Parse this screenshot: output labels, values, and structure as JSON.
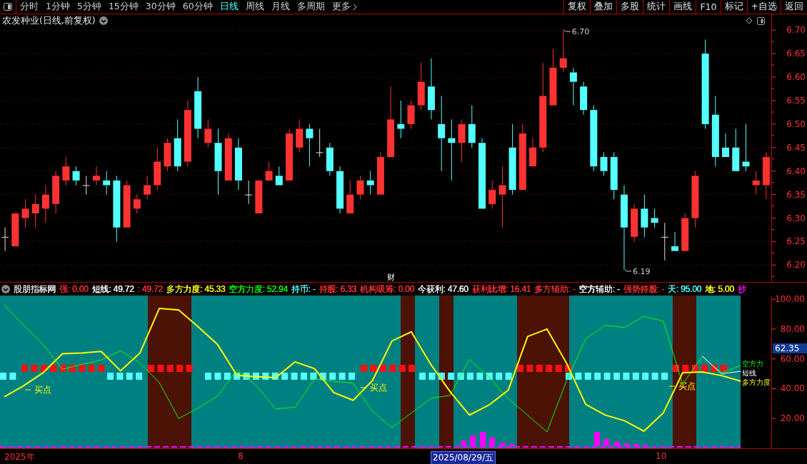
{
  "toolbar": {
    "periods": [
      {
        "label": "分时",
        "selected": false
      },
      {
        "label": "1分钟",
        "selected": false
      },
      {
        "label": "5分钟",
        "selected": false
      },
      {
        "label": "15分钟",
        "selected": false
      },
      {
        "label": "30分钟",
        "selected": false
      },
      {
        "label": "60分钟",
        "selected": false
      },
      {
        "label": "日线",
        "selected": true
      },
      {
        "label": "周线",
        "selected": false
      },
      {
        "label": "月线",
        "selected": false
      },
      {
        "label": "多周期",
        "selected": false
      },
      {
        "label": "更多",
        "selected": false
      }
    ],
    "buttons": [
      "复权",
      "叠加",
      "多股",
      "统计",
      "画线",
      "F10",
      "标记",
      "+自选",
      "返回"
    ]
  },
  "price_chart": {
    "title": "农发种业(日线,前复权)",
    "marker": "财",
    "chart_data": {
      "type": "candlestick",
      "categories": [
        null,
        null,
        null,
        null,
        null,
        null,
        null,
        null,
        null,
        null,
        null,
        null,
        null,
        null,
        null,
        null,
        null,
        null,
        null,
        null,
        null,
        null,
        null,
        null,
        null,
        null,
        null,
        null,
        null,
        null,
        null,
        null,
        null,
        null,
        null,
        null,
        null,
        null,
        null,
        null,
        null,
        null,
        null,
        null,
        null,
        null,
        null,
        null,
        null,
        null,
        null,
        null,
        null,
        null,
        null,
        null,
        null,
        null,
        null,
        null,
        null,
        null,
        null,
        null,
        null,
        null,
        null,
        null,
        null,
        null,
        null,
        null,
        null,
        null,
        null,
        null
      ],
      "ohlc": [
        [
          6.26,
          6.28,
          6.23,
          6.26
        ],
        [
          6.24,
          6.31,
          6.24,
          6.31
        ],
        [
          6.3,
          6.34,
          6.28,
          6.32
        ],
        [
          6.31,
          6.35,
          6.28,
          6.33
        ],
        [
          6.32,
          6.37,
          6.29,
          6.35
        ],
        [
          6.33,
          6.4,
          6.31,
          6.39
        ],
        [
          6.38,
          6.43,
          6.37,
          6.41
        ],
        [
          6.4,
          6.41,
          6.37,
          6.38
        ],
        [
          6.37,
          6.39,
          6.35,
          6.37
        ],
        [
          6.38,
          6.41,
          6.37,
          6.39
        ],
        [
          6.38,
          6.4,
          6.35,
          6.37
        ],
        [
          6.38,
          6.39,
          6.25,
          6.28
        ],
        [
          6.28,
          6.38,
          6.28,
          6.37
        ],
        [
          6.32,
          6.35,
          6.31,
          6.34
        ],
        [
          6.35,
          6.39,
          6.34,
          6.37
        ],
        [
          6.37,
          6.45,
          6.36,
          6.42
        ],
        [
          6.41,
          6.47,
          6.4,
          6.46
        ],
        [
          6.47,
          6.51,
          6.4,
          6.41
        ],
        [
          6.42,
          6.55,
          6.41,
          6.53
        ],
        [
          6.57,
          6.6,
          6.47,
          6.49
        ],
        [
          6.46,
          6.51,
          6.45,
          6.49
        ],
        [
          6.46,
          6.49,
          6.35,
          6.4
        ],
        [
          6.38,
          6.48,
          6.38,
          6.47
        ],
        [
          6.45,
          6.47,
          6.36,
          6.38
        ],
        [
          6.35,
          6.38,
          6.33,
          6.35
        ],
        [
          6.31,
          6.38,
          6.31,
          6.38
        ],
        [
          6.38,
          6.42,
          6.38,
          6.4
        ],
        [
          6.39,
          6.41,
          6.37,
          6.37
        ],
        [
          6.38,
          6.49,
          6.38,
          6.48
        ],
        [
          6.45,
          6.51,
          6.44,
          6.49
        ],
        [
          6.49,
          6.5,
          6.41,
          6.47
        ],
        [
          6.44,
          6.49,
          6.43,
          6.44
        ],
        [
          6.45,
          6.46,
          6.39,
          6.4
        ],
        [
          6.4,
          6.41,
          6.31,
          6.32
        ],
        [
          6.31,
          6.38,
          6.31,
          6.35
        ],
        [
          6.35,
          6.39,
          6.34,
          6.38
        ],
        [
          6.38,
          6.4,
          6.35,
          6.37
        ],
        [
          6.35,
          6.44,
          6.35,
          6.43
        ],
        [
          6.43,
          6.58,
          6.43,
          6.51
        ],
        [
          6.5,
          6.55,
          6.47,
          6.49
        ],
        [
          6.5,
          6.55,
          6.49,
          6.54
        ],
        [
          6.54,
          6.63,
          6.53,
          6.59
        ],
        [
          6.58,
          6.64,
          6.51,
          6.53
        ],
        [
          6.5,
          6.56,
          6.4,
          6.47
        ],
        [
          6.47,
          6.51,
          6.38,
          6.46
        ],
        [
          6.46,
          6.51,
          6.42,
          6.5
        ],
        [
          6.5,
          6.54,
          6.45,
          6.46
        ],
        [
          6.46,
          6.47,
          6.32,
          6.32
        ],
        [
          6.33,
          6.38,
          6.32,
          6.36
        ],
        [
          6.35,
          6.41,
          6.28,
          6.37
        ],
        [
          6.45,
          6.5,
          6.35,
          6.36
        ],
        [
          6.36,
          6.5,
          6.36,
          6.48
        ],
        [
          6.41,
          6.47,
          6.41,
          6.45
        ],
        [
          6.45,
          6.63,
          6.44,
          6.56
        ],
        [
          6.54,
          6.66,
          6.54,
          6.62
        ],
        [
          6.62,
          6.7,
          6.61,
          6.64
        ],
        [
          6.61,
          6.62,
          6.54,
          6.59
        ],
        [
          6.58,
          6.59,
          6.52,
          6.53
        ],
        [
          6.53,
          6.54,
          6.4,
          6.41
        ],
        [
          6.43,
          6.44,
          6.39,
          6.4
        ],
        [
          6.43,
          6.44,
          6.34,
          6.36
        ],
        [
          6.35,
          6.37,
          6.19,
          6.28
        ],
        [
          6.26,
          6.33,
          6.25,
          6.32
        ],
        [
          6.32,
          6.35,
          6.26,
          6.28
        ],
        [
          6.3,
          6.32,
          6.28,
          6.29
        ],
        [
          6.26,
          6.29,
          6.21,
          6.26
        ],
        [
          6.24,
          6.27,
          6.23,
          6.23
        ],
        [
          6.23,
          6.31,
          6.23,
          6.3
        ],
        [
          6.3,
          6.4,
          6.28,
          6.39
        ],
        [
          6.65,
          6.68,
          6.49,
          6.5
        ],
        [
          6.52,
          6.56,
          6.41,
          6.43
        ],
        [
          6.45,
          6.48,
          6.43,
          6.43
        ],
        [
          6.45,
          6.49,
          6.4,
          6.4
        ],
        [
          6.42,
          6.5,
          6.4,
          6.41
        ],
        [
          6.37,
          6.4,
          6.35,
          6.38
        ],
        [
          6.37,
          6.44,
          6.34,
          6.43
        ]
      ],
      "ylim": [
        6.161,
        6.736
      ],
      "grid": true,
      "yticks": [
        {
          "value": 6.7,
          "label": "6.70"
        },
        {
          "value": 6.65,
          "label": "6.65"
        },
        {
          "value": 6.6,
          "label": "6.60"
        },
        {
          "value": 6.55,
          "label": "6.55"
        },
        {
          "value": 6.5,
          "label": "6.50"
        },
        {
          "value": 6.45,
          "label": "6.45"
        },
        {
          "value": 6.4,
          "label": "6.40"
        },
        {
          "value": 6.35,
          "label": "6.35"
        },
        {
          "value": 6.3,
          "label": "6.30"
        },
        {
          "value": 6.25,
          "label": "6.25"
        },
        {
          "value": 6.2,
          "label": "6.20"
        }
      ]
    },
    "high_label": "6.70",
    "low_label": "6.19"
  },
  "indicator": {
    "name": "股朋指标网",
    "items": [
      {
        "text": "强: 0.00",
        "color": "#ff3232"
      },
      {
        "text": "短线: 49.72",
        "color": "#ffffff"
      },
      {
        "text": ": 49.72",
        "color": "#ff3232"
      },
      {
        "text": "多方力度: 45.33",
        "color": "#ffff00"
      },
      {
        "text": "空方力度: 52.94",
        "color": "#00ff00"
      },
      {
        "text": "持币: -",
        "color": "#54ffff"
      },
      {
        "text": "持股: 6.33",
        "color": "#ff3232"
      },
      {
        "text": "机构吸筹: 0.00",
        "color": "#ff3232"
      },
      {
        "text": "今获利: 47.60",
        "color": "#ffffff"
      },
      {
        "text": "获利比增: 16.41",
        "color": "#ff3232"
      },
      {
        "text": "多方辅助: -",
        "color": "#ff3232"
      },
      {
        "text": "空方辅助: -",
        "color": "#ffffff"
      },
      {
        "text": "强势持股: -",
        "color": "#ff3232"
      },
      {
        "text": "天: 95.00",
        "color": "#54ffff"
      },
      {
        "text": "地: 5.00",
        "color": "#ffff00"
      },
      {
        "text": "抄",
        "color": "#ff00ff"
      }
    ],
    "chart_data": {
      "type": "line",
      "ylim": [
        0,
        102.5
      ],
      "legend": "right",
      "yticks": [
        {
          "value": 100,
          "label": "100.00"
        },
        {
          "value": 80,
          "label": "80.00"
        },
        {
          "value": 60,
          "label": "60.00"
        },
        {
          "value": 40,
          "label": "40.00"
        },
        {
          "value": 20,
          "label": "20.00"
        }
      ],
      "series": [
        {
          "name": "多方力度",
          "color": "#ffff00",
          "values": [
            34.6,
            42,
            50.7,
            63.5,
            64,
            65,
            52,
            64,
            93.9,
            92.8,
            81.5,
            69.7,
            49,
            48,
            47.4,
            58,
            53.5,
            37.4,
            32.2,
            45.5,
            72,
            78.2,
            56.4,
            38,
            22.3,
            29,
            39,
            75,
            80,
            57.3,
            29.4,
            22.3,
            18.5,
            11.5,
            23.7,
            50.7,
            51.2,
            48.8,
            45
          ]
        },
        {
          "name": "空方力",
          "color": "#00ff00",
          "values": [
            96.2,
            82.5,
            69.7,
            53,
            56.4,
            59.2,
            65.4,
            57.3,
            44,
            20,
            27,
            35,
            52.6,
            42.2,
            26.5,
            27.5,
            46.4,
            45,
            43.6,
            24.6,
            14,
            23.7,
            33.6,
            35.5,
            59.7,
            47.9,
            33.2,
            22.3,
            11,
            45,
            73.5,
            82.5,
            81,
            88.5,
            85.3,
            43,
            61.6,
            50.7,
            55.5
          ]
        },
        {
          "name": "短线",
          "color": "#ffffff",
          "values": [
            null,
            null,
            null,
            null,
            null,
            null,
            null,
            null,
            null,
            null,
            null,
            null,
            null,
            null,
            null,
            null,
            null,
            null,
            null,
            null,
            null,
            null,
            null,
            null,
            null,
            null,
            null,
            null,
            null,
            null,
            null,
            null,
            null,
            null,
            null,
            null,
            62,
            50,
            51.7
          ]
        }
      ]
    },
    "current_value": "62.35",
    "buy_labels": [
      "买点",
      "买点",
      "买点"
    ]
  },
  "date_axis": [
    {
      "label": "2025年",
      "selected": false
    },
    {
      "label": "8",
      "selected": false
    },
    {
      "label": "2025/08/29/五",
      "selected": true
    },
    {
      "label": "10",
      "selected": false
    }
  ]
}
